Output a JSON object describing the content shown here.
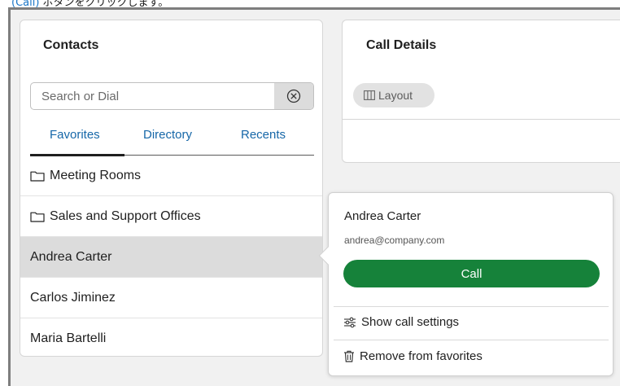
{
  "caption": {
    "link_text": "(Call)",
    "text": " ボタンをクリックします。"
  },
  "contacts": {
    "title": "Contacts",
    "search": {
      "placeholder": "Search or Dial",
      "value": ""
    },
    "tabs": [
      {
        "label": "Favorites",
        "active": true
      },
      {
        "label": "Directory",
        "active": false
      },
      {
        "label": "Recents",
        "active": false
      }
    ],
    "items": [
      {
        "label": "Meeting Rooms",
        "icon": "folder-icon"
      },
      {
        "label": "Sales and Support Offices",
        "icon": "folder-icon"
      },
      {
        "label": "Andrea Carter",
        "selected": true
      },
      {
        "label": "Carlos Jiminez"
      },
      {
        "label": "Maria Bartelli"
      }
    ]
  },
  "call_details": {
    "title": "Call Details",
    "layout_label": "Layout"
  },
  "popover": {
    "name": "Andrea Carter",
    "email": "andrea@company.com",
    "call_label": "Call",
    "show_settings_label": "Show call settings",
    "remove_label": "Remove from favorites"
  },
  "colors": {
    "accent_link": "#1667a8",
    "call_green": "#16823a",
    "selected_row": "#dcdcdc"
  }
}
